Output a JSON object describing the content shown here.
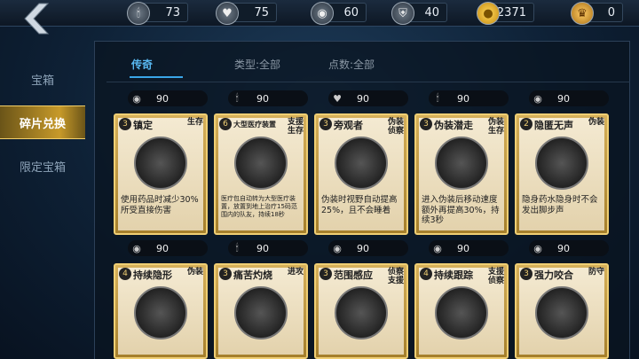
{
  "resources": [
    {
      "icon": "stamina-icon",
      "value": "73"
    },
    {
      "icon": "heart-icon",
      "value": "75"
    },
    {
      "icon": "eye-icon",
      "value": "60"
    },
    {
      "icon": "shield-icon",
      "value": "40"
    },
    {
      "icon": "coin-icon",
      "value": "2371"
    },
    {
      "icon": "trophy-icon",
      "value": "0"
    }
  ],
  "nav": [
    {
      "label": "宝箱"
    },
    {
      "label": "碎片兑换"
    },
    {
      "label": "限定宝箱"
    }
  ],
  "tabs": [
    {
      "label": "传奇"
    },
    {
      "label": "类型:全部"
    },
    {
      "label": "点数:全部"
    }
  ],
  "cards": [
    {
      "price_icon": "eye-icon",
      "price": "90",
      "level": "3",
      "name": "镇定",
      "tag": "生存",
      "icon": "medkit-icon",
      "desc": "使用药品时减少30%所受直接伤害"
    },
    {
      "price_icon": "stamina-icon",
      "price": "90",
      "level": "6",
      "name": "大型医疗装置",
      "tag": "支援\n生存",
      "icon": "medical-device-icon",
      "desc": "医疗包自动转为大型医疗装置，放置到地上治疗15码范围内的队友，持续18秒"
    },
    {
      "price_icon": "heart-icon",
      "price": "90",
      "level": "3",
      "name": "旁观者",
      "tag": "伪装\n侦察",
      "icon": "tire-eye-icon",
      "desc": "伪装时视野自动提高25%，且不会睡着"
    },
    {
      "price_icon": "stamina-icon",
      "price": "90",
      "level": "3",
      "name": "伪装潜走",
      "tag": "伪装\n生存",
      "icon": "tire-stack-icon",
      "desc": "进入伪装后移动速度额外再提高30%，持续3秒"
    },
    {
      "price_icon": "eye-icon",
      "price": "90",
      "level": "2",
      "name": "隐匿无声",
      "tag": "伪装",
      "icon": "syringe-icon",
      "desc": "隐身药水隐身时不会发出脚步声"
    },
    {
      "price_icon": "eye-icon",
      "price": "90",
      "level": "4",
      "name": "持续隐形",
      "tag": "伪装",
      "icon": "invisibility-syringe-icon",
      "desc": ""
    },
    {
      "price_icon": "stamina-icon",
      "price": "90",
      "level": "3",
      "name": "痛苦灼烧",
      "tag": "进攻",
      "icon": "bottle-icon",
      "desc": ""
    },
    {
      "price_icon": "eye-icon",
      "price": "90",
      "level": "3",
      "name": "范围感应",
      "tag": "侦察\n支援",
      "icon": "radar-icon",
      "desc": ""
    },
    {
      "price_icon": "eye-icon",
      "price": "90",
      "level": "4",
      "name": "持续跟踪",
      "tag": "支援\n侦察",
      "icon": "tracker-icon",
      "desc": ""
    },
    {
      "price_icon": "eye-icon",
      "price": "90",
      "level": "3",
      "name": "强力咬合",
      "tag": "防守",
      "icon": "bear-trap-icon",
      "desc": ""
    }
  ]
}
